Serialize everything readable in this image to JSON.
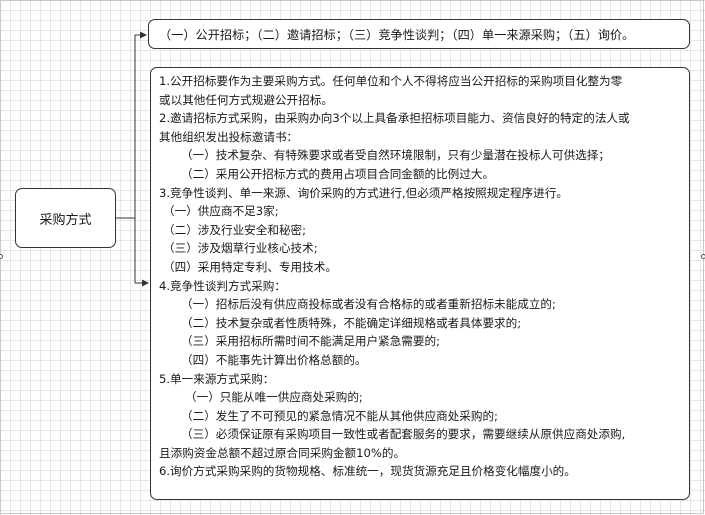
{
  "root": {
    "label": "采购方式"
  },
  "methods_summary": "（一）公开招标；（二）邀请招标；（三）竞争性谈判；（四）单一来源采购；（五）询价。",
  "details": [
    {
      "text": "1.公开招标要作为主要采购方式。任何单位和个人不得将应当公开招标的采购项目化整为零",
      "style": "0"
    },
    {
      "text": "或以其他任何方式规避公开招标。",
      "style": "0"
    },
    {
      "text": "2.邀请招标方式采购，由采购办向3个以上具备承担招标项目能力、资信良好的特定的法人或",
      "style": "0"
    },
    {
      "text": "其他组织发出投标邀请书：",
      "style": "0"
    },
    {
      "text": "（一）技术复杂、有特殊要求或者受自然环境限制，只有少量潜在投标人可供选择；",
      "style": "1"
    },
    {
      "text": "（二）采用公开招标方式的费用占项目合同金额的比例过大。",
      "style": "1"
    },
    {
      "text": "3.竞争性谈判、单一来源、询价采购的方式进行,但必须严格按照规定程序进行。",
      "style": "0"
    },
    {
      "text": "（一）供应商不足3家;",
      "style": "2"
    },
    {
      "text": "（二）涉及行业安全和秘密;",
      "style": "2"
    },
    {
      "text": "（三）涉及烟草行业核心技术;",
      "style": "2"
    },
    {
      "text": "（四）采用特定专利、专用技术。",
      "style": "2"
    },
    {
      "text": "4.竞争性谈判方式采购：",
      "style": "0"
    },
    {
      "text": "（一）招标后没有供应商投标或者没有合格标的或者重新招标未能成立的;",
      "style": "1"
    },
    {
      "text": "（二）技术复杂或者性质特殊，不能确定详细规格或者具体要求的;",
      "style": "1"
    },
    {
      "text": "（三）采用招标所需时间不能满足用户紧急需要的;",
      "style": "1"
    },
    {
      "text": "（四）不能事先计算出价格总额的。",
      "style": "1"
    },
    {
      "text": "5.单一来源方式采购：",
      "style": "0"
    },
    {
      "text": "（一）只能从唯一供应商处采购的;",
      "style": "3"
    },
    {
      "text": "（二）发生了不可预见的紧急情况不能从其他供应商处采购的;",
      "style": "1"
    },
    {
      "text": "（三）必须保证原有采购项目一致性或者配套服务的要求，需要继续从原供应商处添购,",
      "style": "1"
    },
    {
      "text": "且添购资金总额不超过原合同采购金额10%的。",
      "style": "0"
    },
    {
      "text": "6.询价方式采购采购的货物规格、标准统一，现货货源充足且价格变化幅度小的。",
      "style": "0"
    }
  ]
}
